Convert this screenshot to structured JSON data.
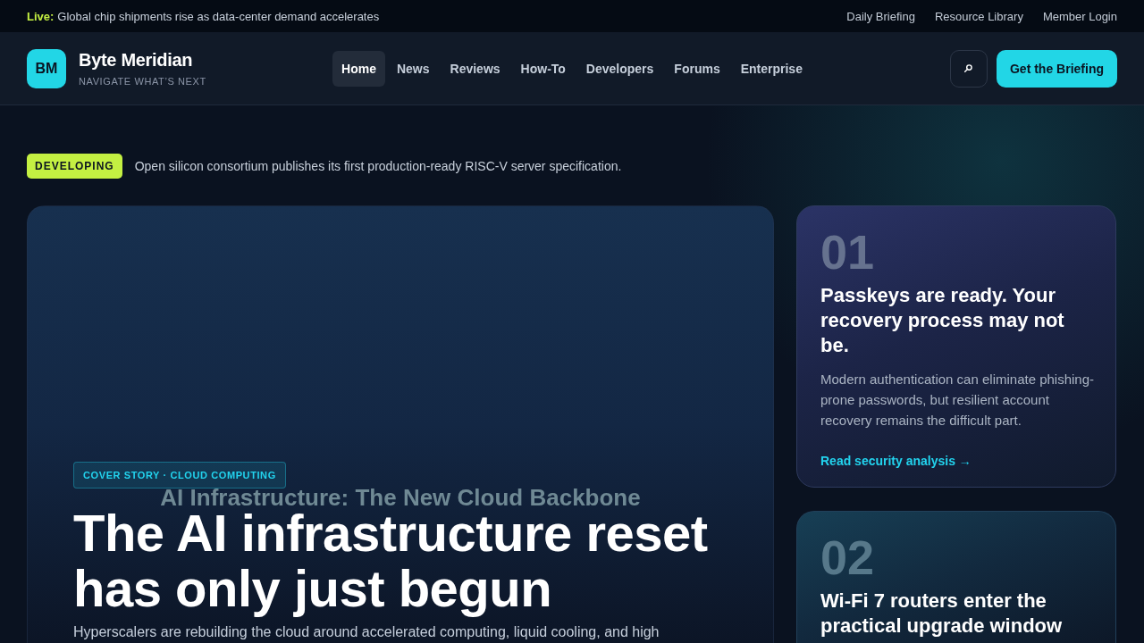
{
  "ticker": {
    "label": "Live:",
    "text": "Global chip shipments rise as data-center demand accelerates"
  },
  "utility_links": [
    "Daily Briefing",
    "Resource Library",
    "Member Login"
  ],
  "brand": {
    "logo": "BM",
    "name": "Byte Meridian",
    "tagline": "NAVIGATE WHAT’S NEXT"
  },
  "nav": [
    {
      "label": "Home",
      "selected": true
    },
    {
      "label": "News",
      "selected": false
    },
    {
      "label": "Reviews",
      "selected": false
    },
    {
      "label": "How-To",
      "selected": false
    },
    {
      "label": "Developers",
      "selected": false
    },
    {
      "label": "Forums",
      "selected": false
    },
    {
      "label": "Enterprise",
      "selected": false
    }
  ],
  "cta": "Get the Briefing",
  "alert": {
    "badge": "DEVELOPING",
    "text": "Open silicon consortium publishes its first production-ready RISC-V server specification."
  },
  "hero": {
    "image_alt": "AI Infrastructure: The New Cloud Backbone",
    "tag": "COVER STORY · CLOUD COMPUTING",
    "title": "The AI infrastructure reset has only just begun",
    "summary": "Hyperscalers are rebuilding the cloud around accelerated computing, liquid cooling, and high"
  },
  "stories": [
    {
      "number": "01",
      "title": "Passkeys are ready. Your recovery process may not be.",
      "summary": "Modern authentication can eliminate phishing-prone passwords, but resilient account recovery remains the difficult part.",
      "link": "Read security analysis →"
    },
    {
      "number": "02",
      "title": "Wi-Fi 7 routers enter the practical upgrade window"
    }
  ]
}
